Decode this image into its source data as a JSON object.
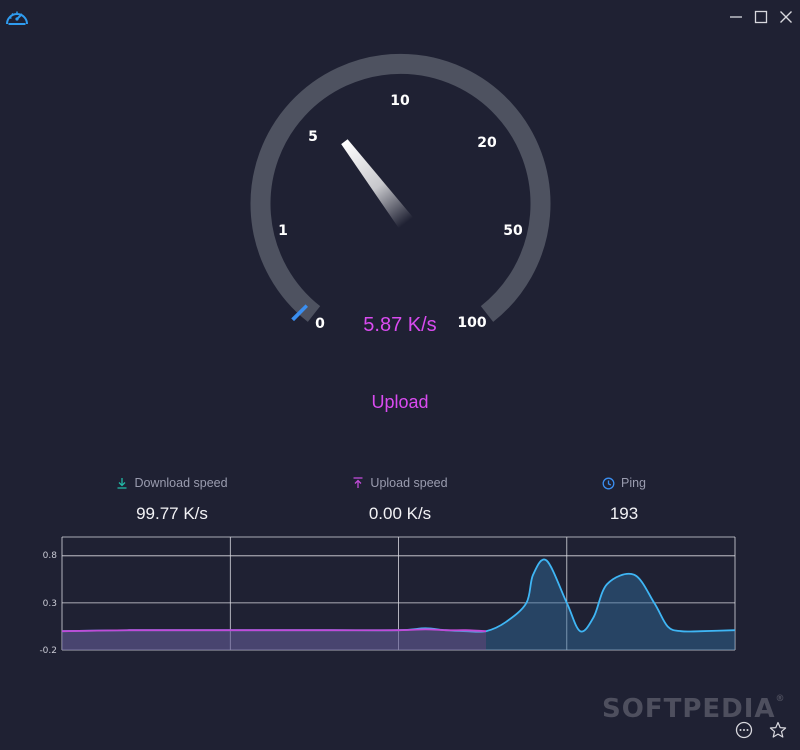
{
  "app": {
    "icon": "speedometer-icon",
    "accent": "#2f9cf0"
  },
  "window_controls": {
    "minimize": "minimize-icon",
    "maximize": "maximize-icon",
    "close": "close-icon"
  },
  "gauge": {
    "scale_labels": [
      "0",
      "1",
      "5",
      "10",
      "20",
      "50",
      "100"
    ],
    "current_value": 5.87,
    "readout": "5.87 K/s",
    "mode": "Upload",
    "needle_color": "#ffffff",
    "track_color": "#4e5260",
    "value_color": "#d94bf0"
  },
  "stats": {
    "download": {
      "label": "Download speed",
      "value": "99.77 K/s",
      "icon": "download-icon",
      "color": "#22b8a6"
    },
    "upload": {
      "label": "Upload speed",
      "value": "0.00 K/s",
      "icon": "upload-icon",
      "color": "#c04bd8"
    },
    "ping": {
      "label": "Ping",
      "value": "193",
      "icon": "clock-icon",
      "color": "#3a8ef0"
    }
  },
  "chart_data": {
    "type": "area",
    "y_tick_labels": [
      "0.8",
      "0.3",
      "-0.2"
    ],
    "ylim": [
      -0.2,
      1.0
    ],
    "grid": true,
    "x_divisions": 4,
    "series": [
      {
        "color": "#c04bd8",
        "x": [
          0,
          0.1,
          0.2,
          0.3,
          0.4,
          0.5,
          0.54,
          0.57,
          0.6,
          0.63
        ],
        "y": [
          0.0,
          0.01,
          0.01,
          0.01,
          0.01,
          0.01,
          0.02,
          0.01,
          0.01,
          0.0
        ]
      },
      {
        "color": "#3fb6f5",
        "x": [
          0,
          0.1,
          0.2,
          0.3,
          0.4,
          0.5,
          0.54,
          0.57,
          0.6,
          0.63,
          0.66,
          0.69,
          0.7,
          0.72,
          0.75,
          0.77,
          0.79,
          0.81,
          0.85,
          0.88,
          0.9,
          0.92,
          0.95,
          1.0
        ],
        "y": [
          0.0,
          0.01,
          0.01,
          0.01,
          0.01,
          0.01,
          0.03,
          0.01,
          0.0,
          0.0,
          0.1,
          0.3,
          0.6,
          0.75,
          0.3,
          0.0,
          0.15,
          0.5,
          0.6,
          0.3,
          0.05,
          0.0,
          0.0,
          0.01
        ]
      }
    ]
  },
  "watermark": {
    "text": "SOFTPEDIA",
    "mark": "®"
  },
  "footer": {
    "more_icon": "more-options-icon",
    "favorite_icon": "star-icon"
  }
}
